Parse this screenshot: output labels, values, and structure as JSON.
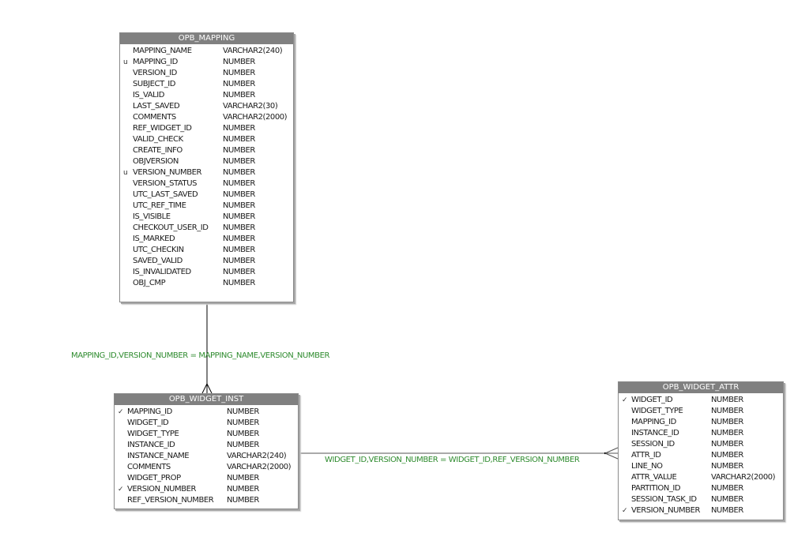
{
  "tables": {
    "mapping": {
      "name": "OPB_MAPPING",
      "columns": [
        {
          "key": "",
          "name": "MAPPING_NAME",
          "type": "VARCHAR2(240)"
        },
        {
          "key": "u",
          "name": "MAPPING_ID",
          "type": "NUMBER"
        },
        {
          "key": "",
          "name": "VERSION_ID",
          "type": "NUMBER"
        },
        {
          "key": "",
          "name": "SUBJECT_ID",
          "type": "NUMBER"
        },
        {
          "key": "",
          "name": "IS_VALID",
          "type": "NUMBER"
        },
        {
          "key": "",
          "name": "LAST_SAVED",
          "type": "VARCHAR2(30)"
        },
        {
          "key": "",
          "name": "COMMENTS",
          "type": "VARCHAR2(2000)"
        },
        {
          "key": "",
          "name": "REF_WIDGET_ID",
          "type": "NUMBER"
        },
        {
          "key": "",
          "name": "VALID_CHECK",
          "type": "NUMBER"
        },
        {
          "key": "",
          "name": "CREATE_INFO",
          "type": "NUMBER"
        },
        {
          "key": "",
          "name": "OBJVERSION",
          "type": "NUMBER"
        },
        {
          "key": "u",
          "name": "VERSION_NUMBER",
          "type": "NUMBER"
        },
        {
          "key": "",
          "name": "VERSION_STATUS",
          "type": "NUMBER"
        },
        {
          "key": "",
          "name": "UTC_LAST_SAVED",
          "type": "NUMBER"
        },
        {
          "key": "",
          "name": "UTC_REF_TIME",
          "type": "NUMBER"
        },
        {
          "key": "",
          "name": "IS_VISIBLE",
          "type": "NUMBER"
        },
        {
          "key": "",
          "name": "CHECKOUT_USER_ID",
          "type": "NUMBER"
        },
        {
          "key": "",
          "name": "IS_MARKED",
          "type": "NUMBER"
        },
        {
          "key": "",
          "name": "UTC_CHECKIN",
          "type": "NUMBER"
        },
        {
          "key": "",
          "name": "SAVED_VALID",
          "type": "NUMBER"
        },
        {
          "key": "",
          "name": "IS_INVALIDATED",
          "type": "NUMBER"
        },
        {
          "key": "",
          "name": "OBJ_CMP",
          "type": "NUMBER"
        }
      ]
    },
    "widget_inst": {
      "name": "OPB_WIDGET_INST",
      "columns": [
        {
          "key": "✓",
          "name": "MAPPING_ID",
          "type": "NUMBER"
        },
        {
          "key": "",
          "name": "WIDGET_ID",
          "type": "NUMBER"
        },
        {
          "key": "",
          "name": "WIDGET_TYPE",
          "type": "NUMBER"
        },
        {
          "key": "",
          "name": "INSTANCE_ID",
          "type": "NUMBER"
        },
        {
          "key": "",
          "name": "INSTANCE_NAME",
          "type": "VARCHAR2(240)"
        },
        {
          "key": "",
          "name": "COMMENTS",
          "type": "VARCHAR2(2000)"
        },
        {
          "key": "",
          "name": "WIDGET_PROP",
          "type": "NUMBER"
        },
        {
          "key": "✓",
          "name": "VERSION_NUMBER",
          "type": "NUMBER"
        },
        {
          "key": "",
          "name": "REF_VERSION_NUMBER",
          "type": "NUMBER"
        }
      ]
    },
    "widget_attr": {
      "name": "OPB_WIDGET_ATTR",
      "columns": [
        {
          "key": "✓",
          "name": "WIDGET_ID",
          "type": "NUMBER"
        },
        {
          "key": "",
          "name": "WIDGET_TYPE",
          "type": "NUMBER"
        },
        {
          "key": "",
          "name": "MAPPING_ID",
          "type": "NUMBER"
        },
        {
          "key": "",
          "name": "INSTANCE_ID",
          "type": "NUMBER"
        },
        {
          "key": "",
          "name": "SESSION_ID",
          "type": "NUMBER"
        },
        {
          "key": "",
          "name": "ATTR_ID",
          "type": "NUMBER"
        },
        {
          "key": "",
          "name": "LINE_NO",
          "type": "NUMBER"
        },
        {
          "key": "",
          "name": "ATTR_VALUE",
          "type": "VARCHAR2(2000)"
        },
        {
          "key": "",
          "name": "PARTITION_ID",
          "type": "NUMBER"
        },
        {
          "key": "",
          "name": "SESSION_TASK_ID",
          "type": "NUMBER"
        },
        {
          "key": "✓",
          "name": "VERSION_NUMBER",
          "type": "NUMBER"
        }
      ]
    }
  },
  "relationships": [
    {
      "from": "OPB_MAPPING",
      "to": "OPB_WIDGET_INST",
      "label": "MAPPING_ID,VERSION_NUMBER = MAPPING_NAME,VERSION_NUMBER",
      "cardinality": "one-to-many"
    },
    {
      "from": "OPB_WIDGET_INST",
      "to": "OPB_WIDGET_ATTR",
      "label": "WIDGET_ID,VERSION_NUMBER = WIDGET_ID,REF_VERSION_NUMBER",
      "cardinality": "one-to-many"
    }
  ],
  "colors": {
    "header_bg": "#808080",
    "header_text": "#ffffff",
    "relationship_label": "#2e8b2e",
    "line": "#000000"
  }
}
